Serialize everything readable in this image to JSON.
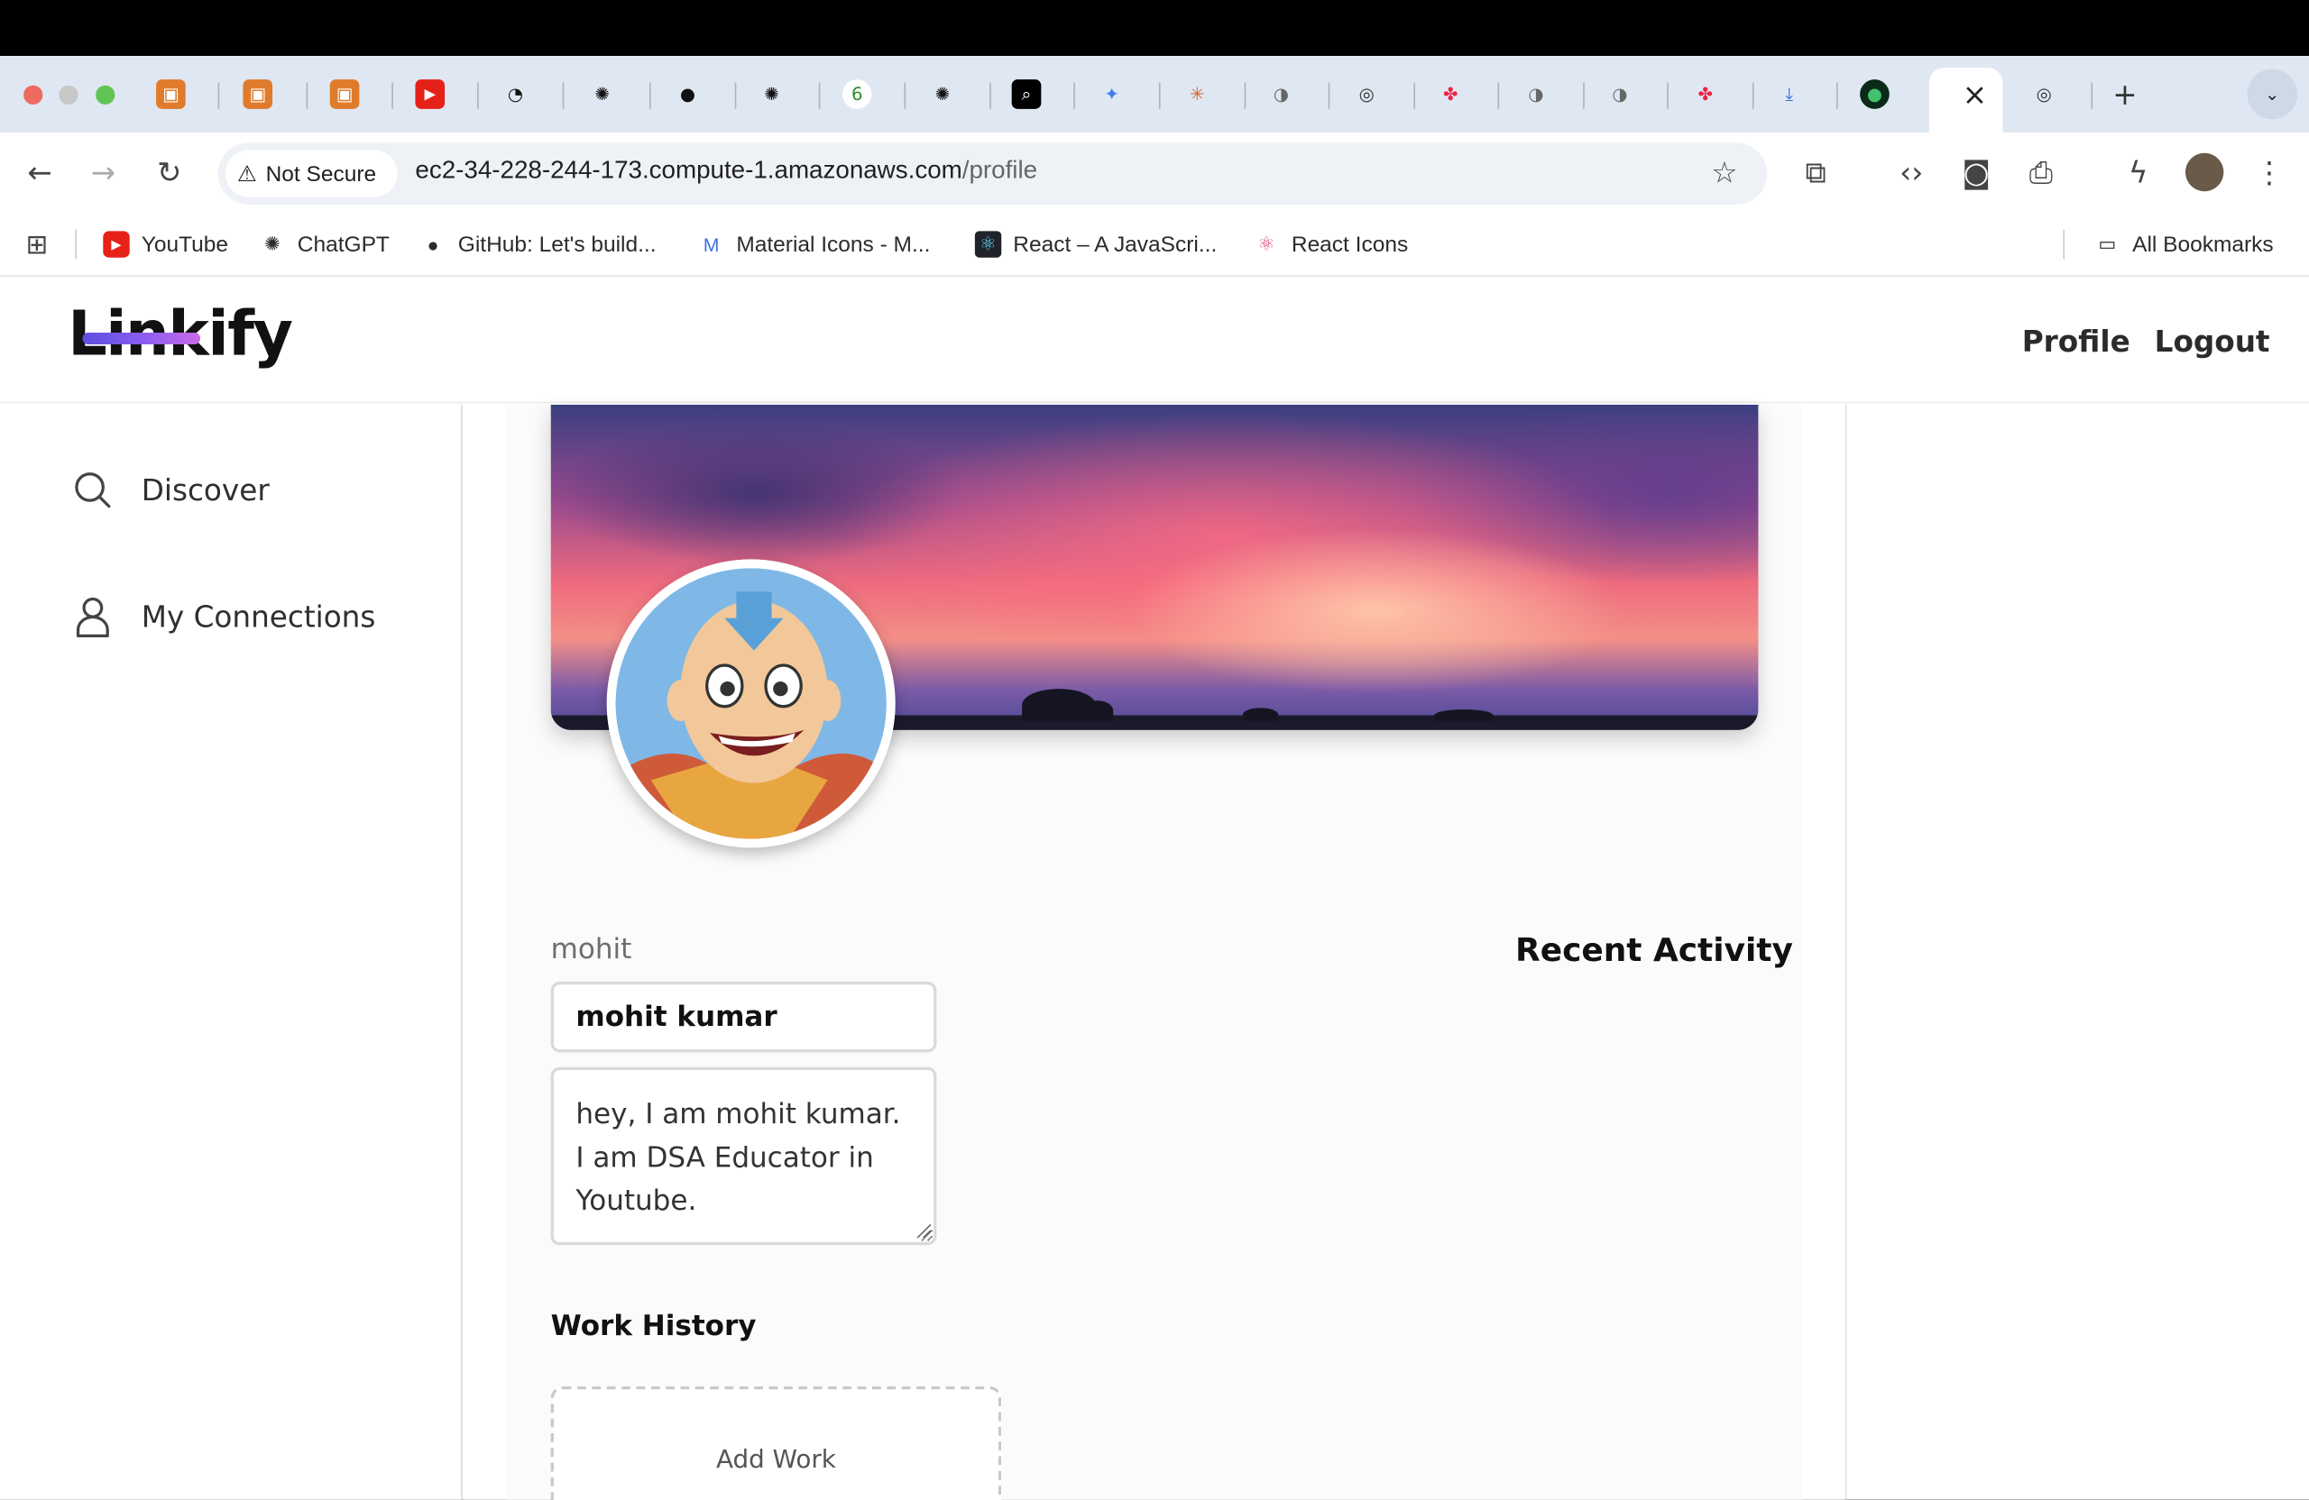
{
  "browser": {
    "chip_label": "Not Secure",
    "url_host": "ec2-34-228-244-173.compute-1.amazonaws.com",
    "url_path": "/profile",
    "tab_close_glyph": "×",
    "new_tab_glyph": "+",
    "bookmarks": [
      {
        "label": "YouTube",
        "icon": "youtube-icon"
      },
      {
        "label": "ChatGPT",
        "icon": "chatgpt-icon"
      },
      {
        "label": "GitHub: Let's build...",
        "icon": "github-icon"
      },
      {
        "label": "Material Icons - M...",
        "icon": "material-icon"
      },
      {
        "label": "React – A JavaScri...",
        "icon": "react-icon"
      },
      {
        "label": "React Icons",
        "icon": "react-icons-icon"
      }
    ],
    "all_bookmarks": "All Bookmarks"
  },
  "app": {
    "logo": "Linkify",
    "nav": {
      "profile": "Profile",
      "logout": "Logout"
    },
    "sidebar": [
      {
        "label": "Discover",
        "icon": "search-icon"
      },
      {
        "label": "My Connections",
        "icon": "user-icon"
      }
    ],
    "profile": {
      "username": "mohit",
      "name": "mohit kumar",
      "bio": "hey, I am mohit kumar. I am DSA Educator in Youtube.",
      "recent_activity": "Recent Activity",
      "work_history": "Work History",
      "add_work": "Add Work"
    }
  },
  "colors": {
    "accent_logo": "#7a55e6",
    "tabstrip_bg": "#dfe7f2",
    "omnibox_bg": "#eef1f6"
  }
}
